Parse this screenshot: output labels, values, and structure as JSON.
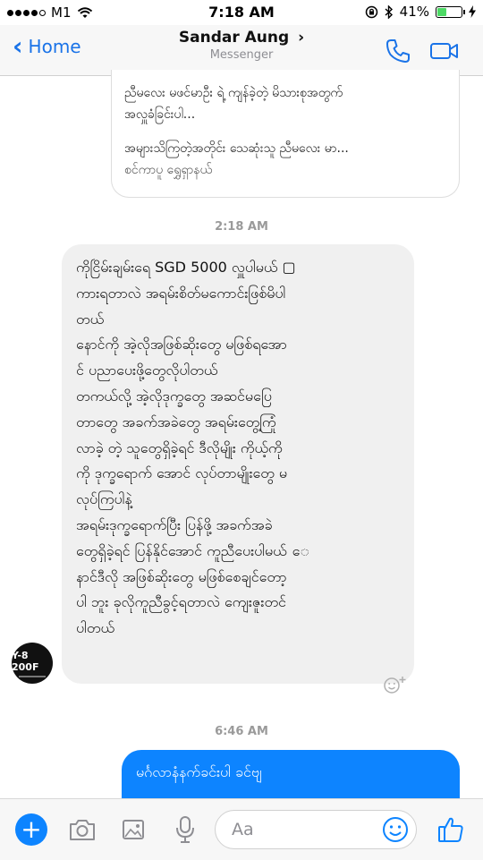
{
  "status_bar": {
    "carrier": "M1",
    "time": "7:18 AM",
    "battery_percent": "41%",
    "battery_level": 0.41,
    "signal_bars": 4,
    "icons": [
      "wifi-icon",
      "orientation-lock-icon",
      "bluetooth-icon",
      "battery-icon",
      "charging-icon"
    ]
  },
  "nav": {
    "back_label": "Home",
    "contact_name": "Sandar Aung",
    "chevron": "›",
    "subtitle": "Messenger",
    "accent_color": "#1a73e8",
    "icons": [
      "phone-icon",
      "video-icon"
    ]
  },
  "quote_card": {
    "lines_top": [
      "ညီမလေး မဖင်မာဦး ရဲ့ ကျန်ခဲ့တဲ့ မိသားစုအတွက်",
      "အလှူခံခြင်းပါ..."
    ],
    "lines_bottom": [
      "အများသိကြတဲ့အတိုင်း သေဆုံးသူ ညီမလေး မာ...",
      "စင်ကာပူ ရွှေရှာနယ်"
    ]
  },
  "timestamps": {
    "first": "2:18 AM",
    "second": "6:46 AM"
  },
  "incoming_message": {
    "lines": [
      "ကိုငြိမ်းချမ်းရေ SGD 5000 လှူပါမယ် ▢",
      "ကားရတာလဲ အရမ်းစိတ်မကောင်းဖြစ်မိပါ",
      "တယ်",
      "နောင်ကို အဲ့လိုအဖြစ်ဆိုးတွေ မဖြစ်ရအော",
      "င် ပညာပေးဖို့တွေလိုပါတယ်",
      "တကယ်လို့ အဲ့လိုဒုက္ခတွေ အဆင်မပြေ",
      "တာတွေ အခက်အခဲတွေ အရမ်းတွေ့ကြုံ",
      "လာခဲ့ တဲ့ သူတွေရှိခဲ့ရင် ဒီလိုမျိုး ကိုယ့်ကို",
      "ကို ဒုက္ခရောက် အောင် လုပ်တာမျိုးတွေ မ",
      "လုပ်ကြပါနဲ့",
      "အရမ်းဒုက္ခရောက်ပြီး ပြန်ဖို့ အခက်အခဲ",
      "တွေရှိခဲ့ရင် ပြန်နိုင်အောင် ကူညီပေးပါမယ် ေ",
      "နာင်ဒီလို အဖြစ်ဆိုးတွေ မဖြစ်စေချင်တော့",
      "ပါ ဘူး ခုလိုကူညီခွင့်ရတာလဲ ကျေးဇူးတင်",
      "ပါတယ်"
    ],
    "avatar_text": "Y-8 200F",
    "bubble_color": "#f0f0f0"
  },
  "outgoing_message": {
    "text": "မင်္ဂလာနံနက်ခင်းပါ ခင်ဗျ",
    "bubble_color": "#0d84ff"
  },
  "composer": {
    "placeholder": "Aa",
    "icons": [
      "plus-icon",
      "camera-icon",
      "photo-icon",
      "microphone-icon",
      "emoji-icon",
      "thumbs-up-icon"
    ]
  }
}
